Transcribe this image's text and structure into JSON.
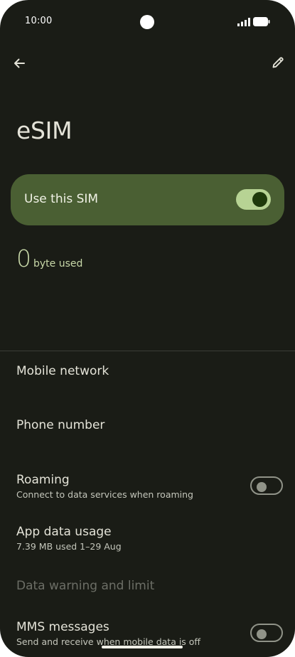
{
  "status_bar": {
    "time": "10:00",
    "signal_icon": "signal-icon",
    "battery_icon": "battery-icon"
  },
  "toolbar": {
    "back_icon": "arrow-back-icon",
    "edit_icon": "pencil-edit-icon"
  },
  "header": {
    "title": "eSIM"
  },
  "sim_switch": {
    "label": "Use this SIM",
    "enabled": true
  },
  "usage": {
    "value": "0",
    "unit": "byte used"
  },
  "settings": [
    {
      "id": "mobile-network",
      "title": "Mobile network",
      "subtitle": ""
    },
    {
      "id": "phone-number",
      "title": "Phone number",
      "subtitle": ""
    },
    {
      "id": "roaming",
      "title": "Roaming",
      "subtitle": "Connect to data services when roaming",
      "toggle": false
    },
    {
      "id": "app-data-usage",
      "title": "App data usage",
      "subtitle": "7.39 MB used 1–29 Aug"
    },
    {
      "id": "data-warning",
      "title": "Data warning and limit",
      "subtitle": "",
      "disabled": true
    },
    {
      "id": "mms-messages",
      "title": "MMS messages",
      "subtitle": "Send and receive when mobile data is off",
      "toggle": false
    }
  ],
  "colors": {
    "background": "#1a1c16",
    "card": "#4a5f33",
    "accent": "#b7d394",
    "usage_text": "#c8d8a8",
    "primary_text": "#e4e3d8"
  }
}
